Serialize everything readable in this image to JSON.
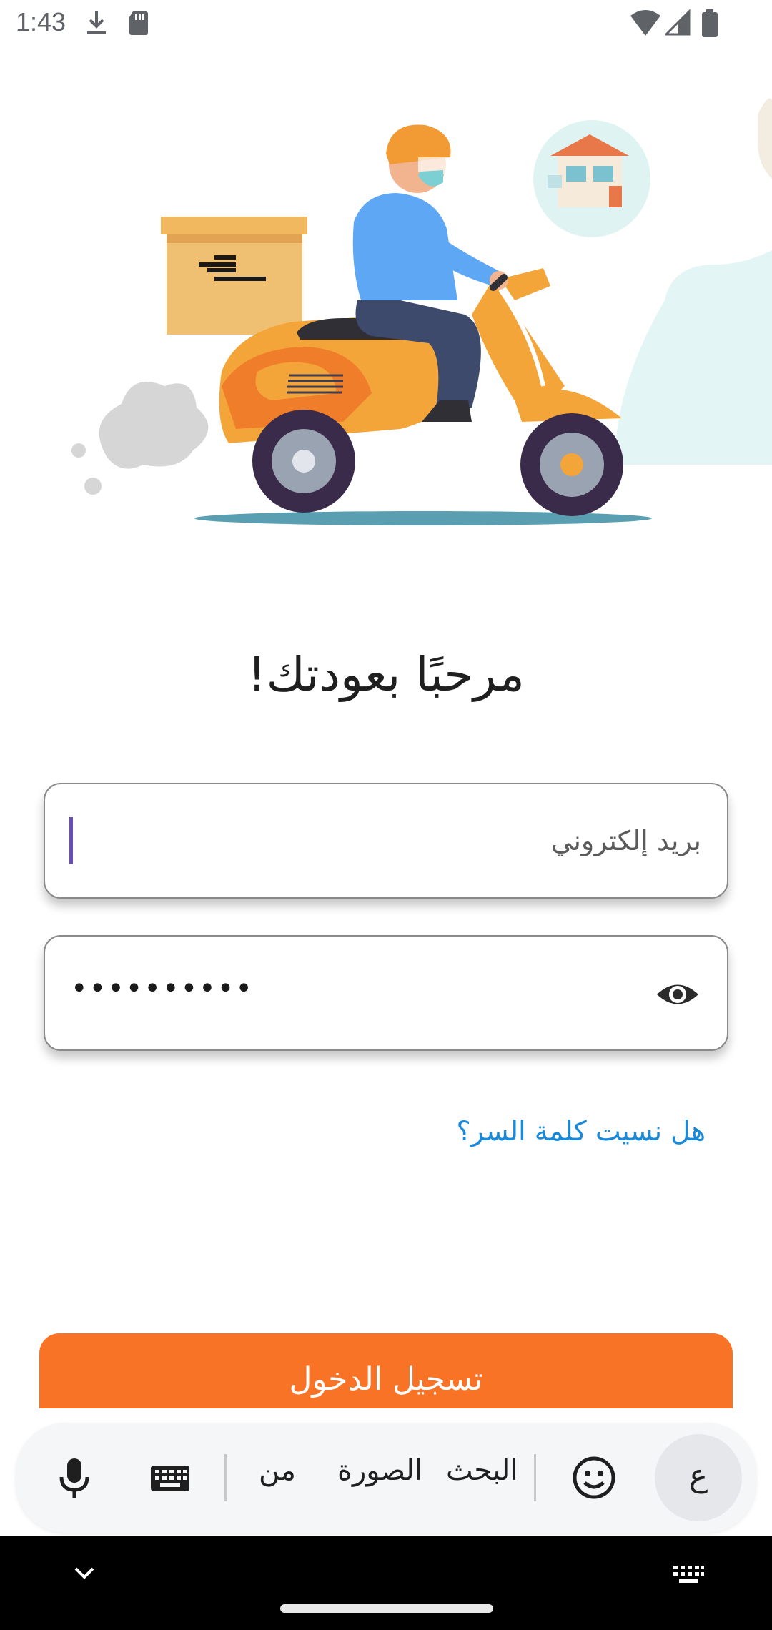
{
  "status_bar": {
    "time": "1:43",
    "icons": [
      "download-icon",
      "sd-card-icon",
      "wifi-icon",
      "signal-icon",
      "battery-icon"
    ]
  },
  "illustration": {
    "subject": "delivery-scooter-illustration"
  },
  "login": {
    "welcome_title": "!مرحبًا بعودتك",
    "email_placeholder": "بريد إلكتروني",
    "email_value": "",
    "password_masked": "••••••••••",
    "forgot_password": "هل نسيت كلمة السر؟",
    "login_button": "تسجيل الدخول"
  },
  "keyboard": {
    "suggestions": [
      "البحث",
      "الصورة",
      "من"
    ],
    "language_key": "ع",
    "icons": [
      "microphone-icon",
      "keyboard-icon",
      "emoji-icon"
    ]
  },
  "colors": {
    "accent": "#f97326",
    "link": "#1a8ad8",
    "caret": "#6a4db8"
  }
}
